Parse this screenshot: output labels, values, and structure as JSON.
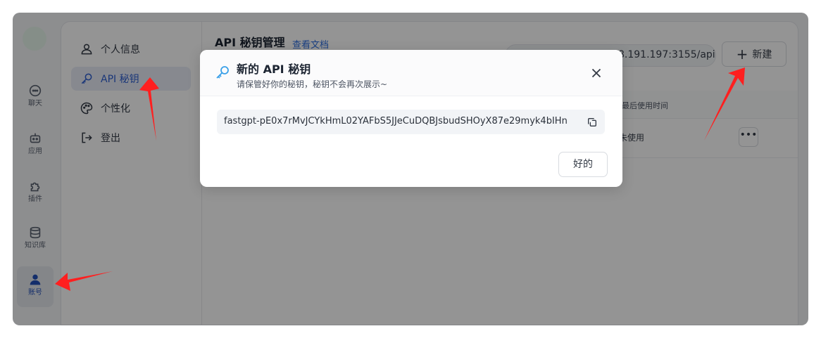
{
  "nav": {
    "items": [
      {
        "label": "聊天",
        "icon": "chat-icon"
      },
      {
        "label": "应用",
        "icon": "robot-icon"
      },
      {
        "label": "插件",
        "icon": "puzzle-icon"
      },
      {
        "label": "知识库",
        "icon": "database-icon"
      },
      {
        "label": "账号",
        "icon": "user-icon"
      }
    ],
    "active": "账号"
  },
  "sidebar": {
    "items": [
      {
        "label": "个人信息",
        "icon": "user-outline-icon"
      },
      {
        "label": "API 秘钥",
        "icon": "key-icon"
      },
      {
        "label": "个性化",
        "icon": "palette-icon"
      },
      {
        "label": "登出",
        "icon": "logout-icon"
      }
    ],
    "active": "API 秘钥"
  },
  "content": {
    "title": "API 秘钥管理",
    "doc_link": "查看文档",
    "base_url": "8.191.197:3155/api",
    "new_button": "新建",
    "table": {
      "header_last_used": "最后使用时间",
      "rows": [
        {
          "last_used": "未使用"
        }
      ]
    },
    "more_icon": "more-icon"
  },
  "modal": {
    "title": "新的 API 秘钥",
    "subtitle": "请保管好你的秘钥，秘钥不会再次展示~",
    "api_key": "fastgpt-pE0x7rMvJCYkHmL02YAFbS5JJeCuDQBJsbudSHOyX87e29myk4bIHn",
    "ok_button": "好的"
  },
  "annotation_color": "#ff1f1f"
}
